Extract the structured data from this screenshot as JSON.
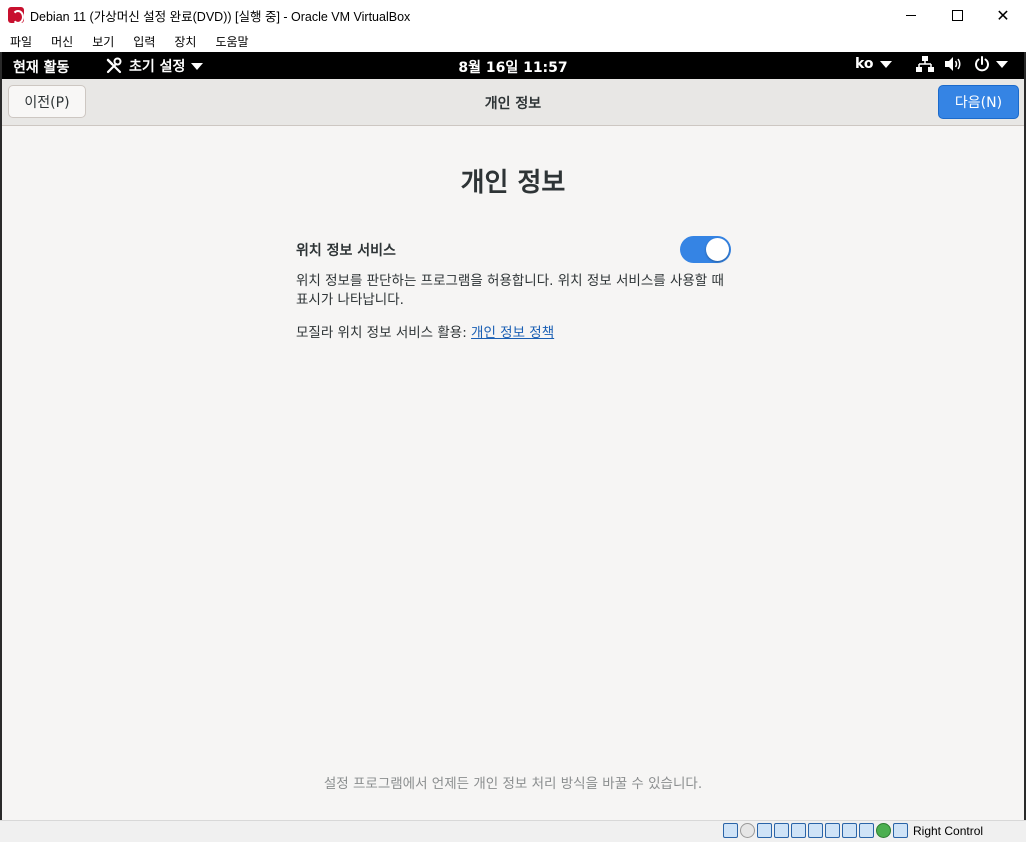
{
  "window": {
    "title": "Debian 11 (가상머신 설정 완료(DVD)) [실행 중] - Oracle VM VirtualBox",
    "minimize": "",
    "maximize": "",
    "close": "✕"
  },
  "menubar": {
    "items": [
      "파일",
      "머신",
      "보기",
      "입력",
      "장치",
      "도움말"
    ]
  },
  "gnome": {
    "activities": "현재 활동",
    "app_menu": "초기 설정",
    "clock": "8월 16일  11:57",
    "language": "ko"
  },
  "header": {
    "prev_label": "이전(P)",
    "title": "개인 정보",
    "next_label": "다음(N)"
  },
  "content": {
    "heading": "개인 정보",
    "location_label": "위치 정보 서비스",
    "location_enabled": true,
    "location_desc": "위치 정보를 판단하는 프로그램을 허용합니다. 위치 정보 서비스를 사용할 때 표시가 나타납니다.",
    "mozilla_prefix": "모질라 위치 정보 서비스 활용: ",
    "privacy_link": "개인 정보 정책",
    "footer": "설정 프로그램에서 언제든 개인 정보 처리 방식을 바꿀 수 있습니다."
  },
  "statusbar": {
    "host_key": "Right Control"
  },
  "colors": {
    "accent": "#3584e4",
    "topbar": "#000000",
    "background": "#f6f5f4"
  }
}
